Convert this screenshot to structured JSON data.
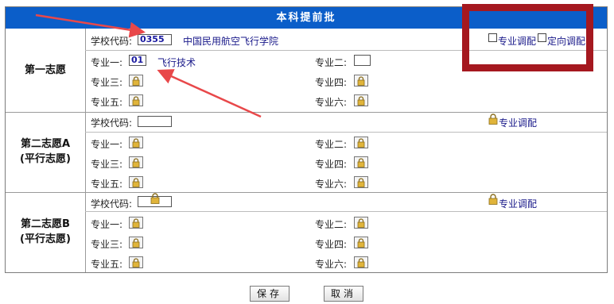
{
  "header": {
    "title": "本科提前批"
  },
  "group1": {
    "title": "第一志愿",
    "school_code_label": "学校代码:",
    "school_code_value": "0355",
    "school_name": "中国民用航空飞行学院",
    "adjust_major_label": "专业调配",
    "adjust_direction_label": "定向调配",
    "major1_label": "专业一:",
    "major1_code": "01",
    "major1_name": "飞行技术",
    "major2_label": "专业二:",
    "major3_label": "专业三:",
    "major4_label": "专业四:",
    "major5_label": "专业五:",
    "major6_label": "专业六:"
  },
  "group2": {
    "title_line1": "第二志愿A",
    "title_line2": "(平行志愿)",
    "school_code_label": "学校代码:",
    "adjust_label": "专业调配",
    "major1_label": "专业一:",
    "major2_label": "专业二:",
    "major3_label": "专业三:",
    "major4_label": "专业四:",
    "major5_label": "专业五:",
    "major6_label": "专业六:"
  },
  "group3": {
    "title_line1": "第二志愿B",
    "title_line2": "(平行志愿)",
    "school_code_label": "学校代码:",
    "adjust_label": "专业调配",
    "major1_label": "专业一:",
    "major2_label": "专业二:",
    "major3_label": "专业三:",
    "major4_label": "专业四:",
    "major5_label": "专业五:",
    "major6_label": "专业六:"
  },
  "buttons": {
    "save": "保存",
    "cancel": "取消"
  },
  "annotations": {
    "highlight_color": "#a5181f",
    "arrow_color": "#e8484a"
  },
  "colors": {
    "header_bg": "#0b5ec9"
  }
}
